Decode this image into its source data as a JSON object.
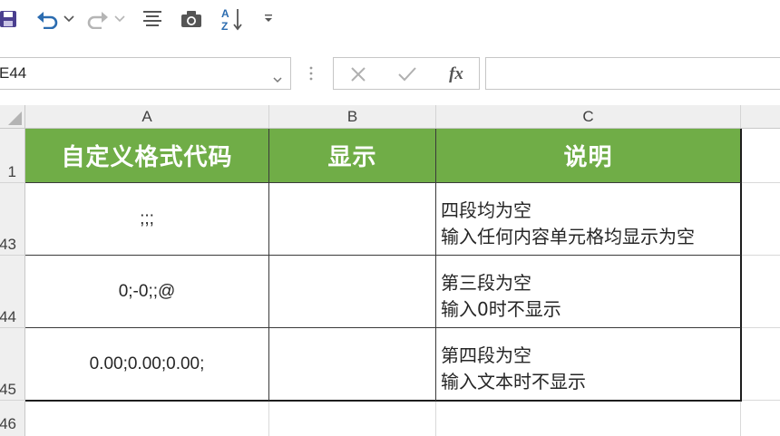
{
  "toolbar": {
    "save_icon": "save-icon",
    "undo_icon": "undo-icon",
    "redo_icon": "redo-icon",
    "align_icon": "align-icon",
    "camera_icon": "camera-icon",
    "sort_icon": "sort-az-icon",
    "sort_label_a": "A",
    "sort_label_z": "Z",
    "customize_icon": "dropdown-icon"
  },
  "formula_bar": {
    "name_box": "E44",
    "cancel_symbol": "✕",
    "enter_symbol": "✓",
    "fx_label": "fx",
    "formula": ""
  },
  "columns": [
    "A",
    "B",
    "C"
  ],
  "rows": [
    {
      "row_number": "1",
      "code": "自定义格式代码",
      "display": "显示",
      "note_lines": [
        "说明"
      ]
    },
    {
      "row_number": "43",
      "code": ";;;",
      "display": "",
      "note_lines": [
        "四段均为空",
        "输入任何内容单元格均显示为空"
      ]
    },
    {
      "row_number": "44",
      "code": "0;-0;;@",
      "display": "",
      "note_lines": [
        "第三段为空",
        "输入0时不显示"
      ]
    },
    {
      "row_number": "45",
      "code": "0.00;0.00;0.00;",
      "display": "",
      "note_lines": [
        "第四段为空",
        "输入文本时不显示"
      ]
    },
    {
      "row_number": "46",
      "code": "",
      "display": "",
      "note_lines": []
    }
  ],
  "colors": {
    "header_fill": "#70ad47",
    "header_text": "#ffffff",
    "grid_line": "#d9d9d9",
    "table_border": "#1e1e1e"
  }
}
